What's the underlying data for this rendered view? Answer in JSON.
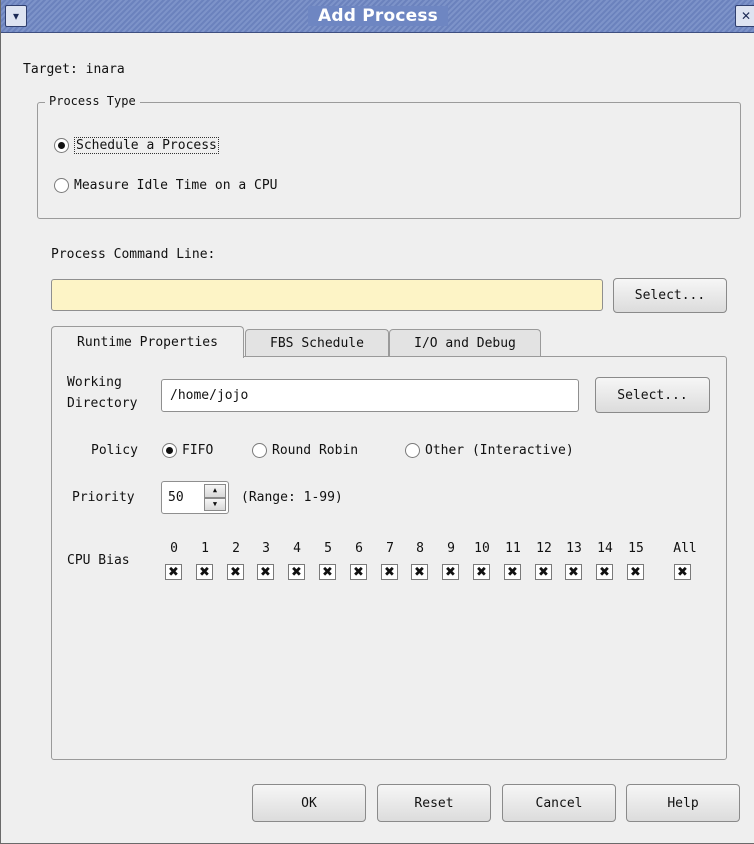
{
  "window": {
    "title": "Add Process"
  },
  "target": {
    "text": "Target: inara"
  },
  "process_type": {
    "legend": "Process Type",
    "options": [
      "Schedule a Process",
      "Measure Idle Time on a CPU"
    ],
    "selected": "Schedule a Process"
  },
  "command": {
    "label": "Process Command Line:",
    "value": "",
    "select_label": "Select..."
  },
  "tabs": [
    "Runtime Properties",
    "FBS Schedule",
    "I/O and Debug"
  ],
  "active_tab": "Runtime Properties",
  "runtime": {
    "wd_label_1": "Working",
    "wd_label_2": "Directory",
    "wd_value": "/home/jojo",
    "wd_select_label": "Select...",
    "policy_label": "Policy",
    "policy_options": [
      "FIFO",
      "Round Robin",
      "Other (Interactive)"
    ],
    "policy_selected": "FIFO",
    "priority_label": "Priority",
    "priority_value": "50",
    "priority_range": "(Range: 1-99)",
    "cpu_bias_label": "CPU Bias",
    "cpus": [
      "0",
      "1",
      "2",
      "3",
      "4",
      "5",
      "6",
      "7",
      "8",
      "9",
      "10",
      "11",
      "12",
      "13",
      "14",
      "15"
    ],
    "all_label": "All",
    "check_mark": "✖"
  },
  "buttons": {
    "ok": "OK",
    "reset": "Reset",
    "cancel": "Cancel",
    "help": "Help"
  },
  "icons": {
    "menu": "chevron-down-icon",
    "close": "close-icon"
  }
}
